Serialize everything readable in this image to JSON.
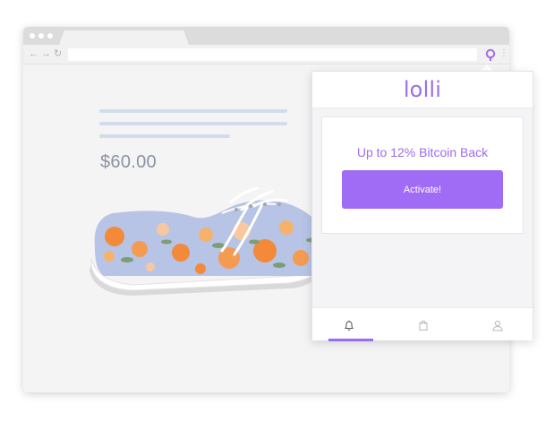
{
  "popup": {
    "brand": "lolli",
    "offer_text": "Up to 12% Bitcoin Back",
    "activate_label": "Activate!",
    "nav": [
      {
        "name": "notifications",
        "icon": "bell-icon",
        "active": true
      },
      {
        "name": "shopping",
        "icon": "shopping-bag-icon",
        "active": false
      },
      {
        "name": "account",
        "icon": "user-icon",
        "active": false
      }
    ]
  },
  "product": {
    "price": "$60.00"
  },
  "colors": {
    "brand": "#9c6bf0",
    "button": "#a06bf5",
    "price": "#8a93a1",
    "placeholder_lines": "#d2dcec"
  },
  "icons": {
    "back": "back-arrow-icon",
    "forward": "forward-arrow-icon",
    "reload": "reload-icon",
    "extension": "lolli-extension-icon",
    "menu": "kebab-menu-icon"
  }
}
